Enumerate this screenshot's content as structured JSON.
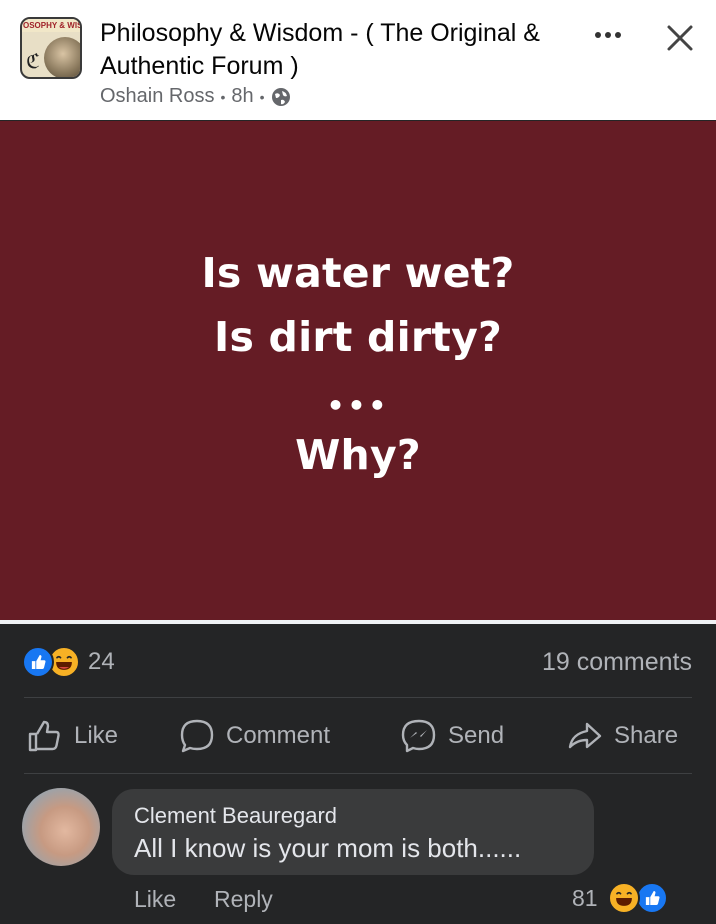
{
  "header": {
    "avatar_banner": "OSOPHY & WISD",
    "group_name": "Philosophy & Wisdom  - ( The Original & Authentic Forum )",
    "author": "Oshain Ross",
    "time": "8h",
    "privacy_icon": "globe-icon",
    "more_icon": "more-dots-icon",
    "close_icon": "close-icon"
  },
  "post_image": {
    "line1": "Is water wet?",
    "line2": "Is dirt dirty?",
    "dots": "•••",
    "line4": "Why?",
    "background": "#651c25"
  },
  "stats": {
    "reaction_icons": [
      "like-reaction-icon",
      "haha-reaction-icon"
    ],
    "reaction_count": "24",
    "comments": "19 comments"
  },
  "actions": {
    "like": "Like",
    "comment": "Comment",
    "send": "Send",
    "share": "Share"
  },
  "comment": {
    "author": "Clement Beauregard",
    "text": "All I know is your mom is both......",
    "like": "Like",
    "reply": "Reply",
    "reaction_count": "81",
    "reaction_icons": [
      "haha-reaction-icon",
      "like-reaction-icon"
    ]
  },
  "colors": {
    "dark_bg": "#242526",
    "bubble": "#3a3b3c",
    "like_blue": "#1877f2",
    "haha_yellow": "#f7b125"
  }
}
